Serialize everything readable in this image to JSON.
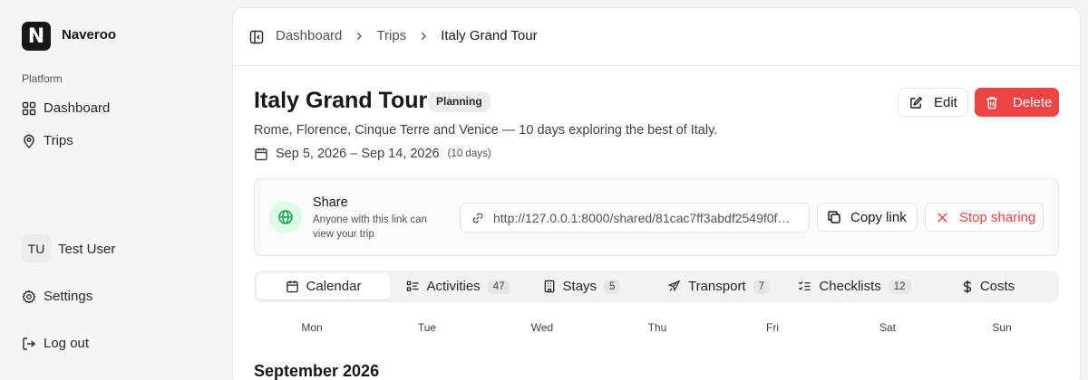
{
  "app": {
    "name": "Naveroo",
    "logo_letter": "N"
  },
  "sidebar": {
    "section_label": "Platform",
    "items": [
      {
        "label": "Dashboard",
        "icon": "grid-icon"
      },
      {
        "label": "Trips",
        "icon": "map-pin-icon"
      }
    ],
    "user": {
      "initials": "TU",
      "name": "Test User"
    },
    "settings_label": "Settings",
    "logout_label": "Log out"
  },
  "breadcrumb": [
    "Dashboard",
    "Trips",
    "Italy Grand Tour"
  ],
  "trip": {
    "title": "Italy Grand Tour",
    "status": "Planning",
    "description": "Rome, Florence, Cinque Terre and Venice — 10 days exploring the best of Italy.",
    "date_range": "Sep 5, 2026 – Sep 14, 2026",
    "duration": "(10 days)"
  },
  "actions": {
    "edit_label": "Edit",
    "delete_label": "Delete"
  },
  "share": {
    "title": "Share",
    "subtitle": "Anyone with this link can view your trip",
    "link": "http://127.0.0.1:8000/shared/81cac7ff3abdf2549f0f…",
    "copy_label": "Copy link",
    "stop_label": "Stop sharing"
  },
  "tabs": [
    {
      "label": "Calendar",
      "count": null,
      "active": true
    },
    {
      "label": "Activities",
      "count": "47"
    },
    {
      "label": "Stays",
      "count": "5"
    },
    {
      "label": "Transport",
      "count": "7"
    },
    {
      "label": "Checklists",
      "count": "12"
    },
    {
      "label": "Costs",
      "count": null
    }
  ],
  "calendar": {
    "weekdays": [
      "Mon",
      "Tue",
      "Wed",
      "Thu",
      "Fri",
      "Sat",
      "Sun"
    ],
    "month": "September 2026"
  },
  "colors": {
    "danger": "#ef4444",
    "share_accent": "#16a34a"
  }
}
